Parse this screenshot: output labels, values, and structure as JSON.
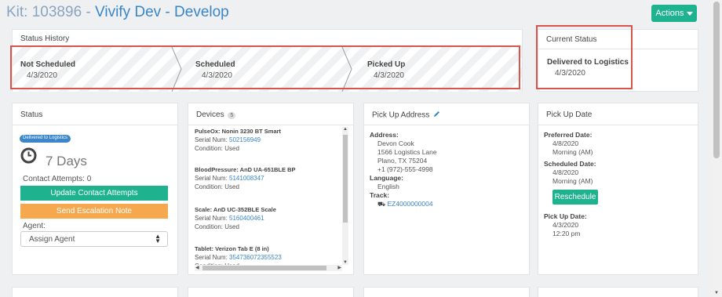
{
  "header": {
    "kit_prefix": "Kit: 103896 -",
    "kit_name": "Vivify Dev - Develop",
    "actions_label": "Actions"
  },
  "status_history": {
    "title": "Status History",
    "steps": [
      {
        "label": "Not Scheduled",
        "date": "4/3/2020"
      },
      {
        "label": "Scheduled",
        "date": "4/3/2020"
      },
      {
        "label": "Picked Up",
        "date": "4/3/2020"
      }
    ]
  },
  "current_status": {
    "title": "Current Status",
    "label": "Delivered to Logistics",
    "date": "4/3/2020"
  },
  "status_card": {
    "title": "Status",
    "badge": "Delivered to Logistics",
    "days": "7 Days",
    "contact_attempts": "Contact Attempts: 0",
    "update_button": "Update Contact Attempts",
    "escalation_button": "Send Escalation Note",
    "agent_label": "Agent:",
    "agent_select": "Assign Agent"
  },
  "devices": {
    "title": "Devices",
    "count": "5",
    "items": [
      {
        "name": "PulseOx: Nonin 3230 BT Smart",
        "serial_label": "Serial Num:",
        "serial": "502156949",
        "condition": "Condition: Used"
      },
      {
        "name": "BloodPressure: AnD UA-651BLE BP",
        "serial_label": "Serial Num:",
        "serial": "5141008347",
        "condition": "Condition: Used"
      },
      {
        "name": "Scale: AnD UC-352BLE Scale",
        "serial_label": "Serial Num:",
        "serial": "5160400461",
        "condition": "Condition: Used"
      },
      {
        "name": "Tablet: Verizon Tab E (8 in)",
        "serial_label": "Serial Num:",
        "serial": "354736072355523",
        "condition": "Condition: Used"
      }
    ]
  },
  "pickup_address": {
    "title": "Pick Up Address",
    "address_label": "Address:",
    "name": "Devon Cook",
    "street": "1566 Logistics Lane",
    "city": "Plano, TX 75204",
    "phone": "+1 (972)-555-4998",
    "language_label": "Language:",
    "language": "English",
    "track_label": "Track:",
    "track": "EZ4000000004"
  },
  "pickup_date": {
    "title": "Pick Up Date",
    "preferred_label": "Preferred Date:",
    "preferred_date": "4/8/2020",
    "preferred_time": "Morning (AM)",
    "scheduled_label": "Scheduled Date:",
    "scheduled_date": "4/8/2020",
    "scheduled_time": "Morning (AM)",
    "reschedule_button": "Reschedule",
    "pickup_label": "Pick Up Date:",
    "pickup_date": "4/3/2020",
    "pickup_time": "12:20 pm"
  },
  "colors": {
    "primary": "#3a86c8",
    "success": "#1fb28f",
    "warning": "#f5a84e",
    "danger": "#d9534f"
  }
}
